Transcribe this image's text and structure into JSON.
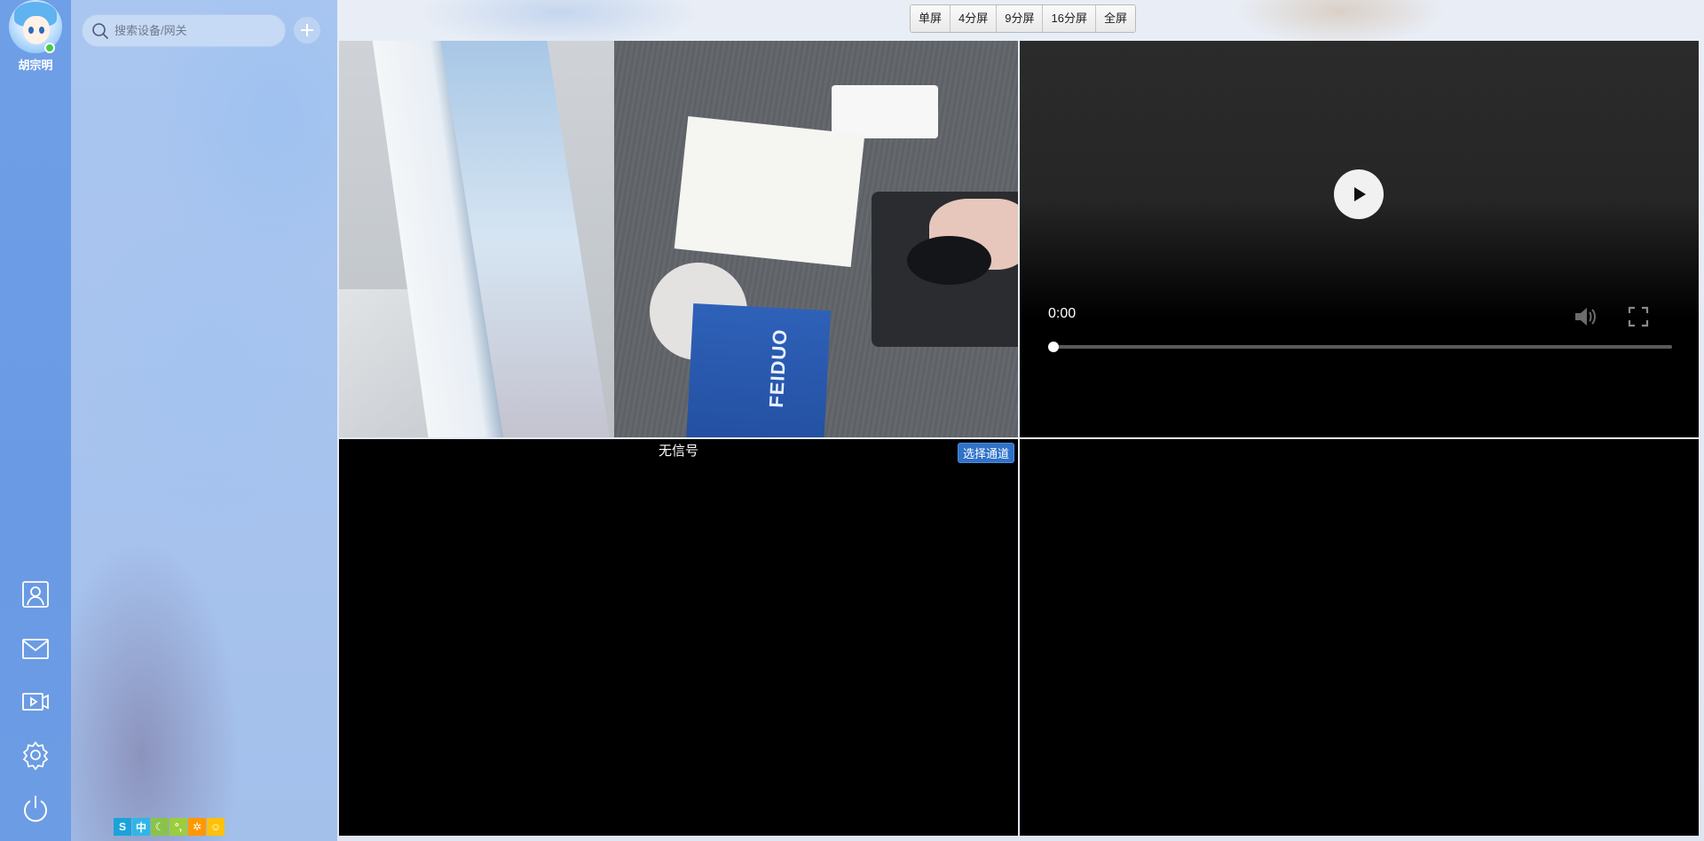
{
  "user": {
    "name": "胡宗明",
    "status": "online"
  },
  "rail": {
    "items": [
      {
        "icon": "contacts-icon"
      },
      {
        "icon": "mail-icon"
      },
      {
        "icon": "video-playback-icon"
      },
      {
        "icon": "gear-icon"
      },
      {
        "icon": "power-icon"
      }
    ]
  },
  "search": {
    "placeholder": "搜索设备/网关",
    "value": ""
  },
  "tray": {
    "items": [
      {
        "icon": "sogou-ime-icon",
        "label": "S",
        "color": "#1aa3d9"
      },
      {
        "icon": "chinese-mode-icon",
        "label": "中",
        "color": "#2fb6e8"
      },
      {
        "icon": "moon-icon",
        "label": "☾",
        "color": "#8bc34a"
      },
      {
        "icon": "punctuation-icon",
        "label": "°,",
        "color": "#9bcd3c"
      },
      {
        "icon": "settings-icon",
        "label": "✲",
        "color": "#ff9800"
      },
      {
        "icon": "emoji-icon",
        "label": "☺",
        "color": "#ffc107"
      }
    ]
  },
  "layout": {
    "buttons": [
      "单屏",
      "4分屏",
      "9分屏",
      "16分屏",
      "全屏"
    ]
  },
  "cells": {
    "cam_box_text": "FEIDUO",
    "player": {
      "time": "0:00",
      "progress": 0
    },
    "no_signal": {
      "text": "无信号",
      "select_channel": "选择通道"
    }
  },
  "colors": {
    "accent": "#2f72c8",
    "online": "#47c94a"
  }
}
